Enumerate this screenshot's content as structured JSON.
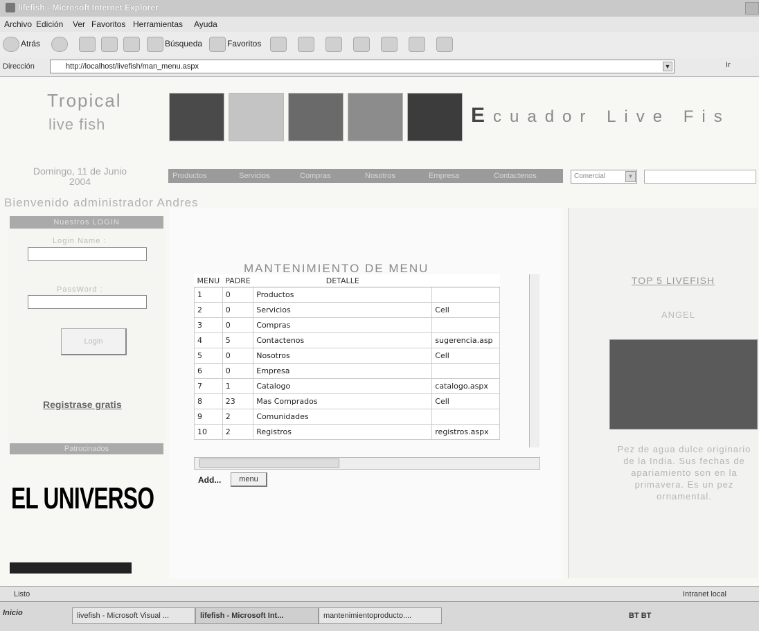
{
  "window": {
    "title": "lifefish - Microsoft Internet Explorer"
  },
  "menubar": [
    "Archivo",
    "Edición",
    "Ver",
    "Favoritos",
    "Herramientas",
    "Ayuda"
  ],
  "toolbar": {
    "back": "Atrás",
    "search": "Búsqueda",
    "favorites": "Favoritos"
  },
  "address": {
    "label": "Dirección",
    "url": "http://localhost/livefish/man_menu.aspx",
    "go": "Ir"
  },
  "site": {
    "logo_line1": "Tropical",
    "logo_line2": "live fish",
    "banner_initial": "E",
    "banner_rest": "cuador Live Fis",
    "date_line1": "Domingo, 11 de Junio",
    "date_line2": "2004",
    "nav": [
      "Productos",
      "Servicios",
      "Compras",
      "Nosotros",
      "Empresa",
      "Contactenos"
    ],
    "category_select": "Comercial",
    "welcome": "Bienvenido administrador Andres"
  },
  "login": {
    "header": "Nuestros LOGIN",
    "name_label": "Login Name :",
    "password_label": "PassWord :",
    "button": "Login",
    "register": "Registrase gratis",
    "partners_header": "Patrocinados",
    "ad_text": "EL UNIVERSO"
  },
  "maint": {
    "title": "MANTENIMIENTO DE MENU",
    "headers": [
      "MENU",
      "PADRE",
      "DETALLE",
      ""
    ],
    "rows": [
      [
        "1",
        "0",
        "Productos",
        ""
      ],
      [
        "2",
        "0",
        "Servicios",
        "Cell"
      ],
      [
        "3",
        "0",
        "Compras",
        ""
      ],
      [
        "4",
        "5",
        "Contactenos",
        "sugerencia.asp"
      ],
      [
        "5",
        "0",
        "Nosotros",
        "Cell"
      ],
      [
        "6",
        "0",
        "Empresa",
        ""
      ],
      [
        "7",
        "1",
        "Catalogo",
        "catalogo.aspx"
      ],
      [
        "8",
        "23",
        "Mas Comprados",
        "Cell"
      ],
      [
        "9",
        "2",
        "Comunidades",
        ""
      ],
      [
        "10",
        "2",
        "Registros",
        "registros.aspx"
      ]
    ],
    "add_label": "Add...",
    "add_button": "menu"
  },
  "top5": {
    "title": "TOP 5 LIVEFISH",
    "fish_name": "ANGEL",
    "description": "Pez de agua dulce originario de la India. Sus fechas de apariamiento son en la primavera. Es un pez ornamental."
  },
  "status": {
    "left": "Listo",
    "right": "Intranet local"
  },
  "taskbar": {
    "start": "Inicio",
    "tasks": [
      "livefish - Microsoft Visual ...",
      "lifefish - Microsoft Int...",
      "mantenimientoproducto...."
    ],
    "tray": "BT BT"
  }
}
